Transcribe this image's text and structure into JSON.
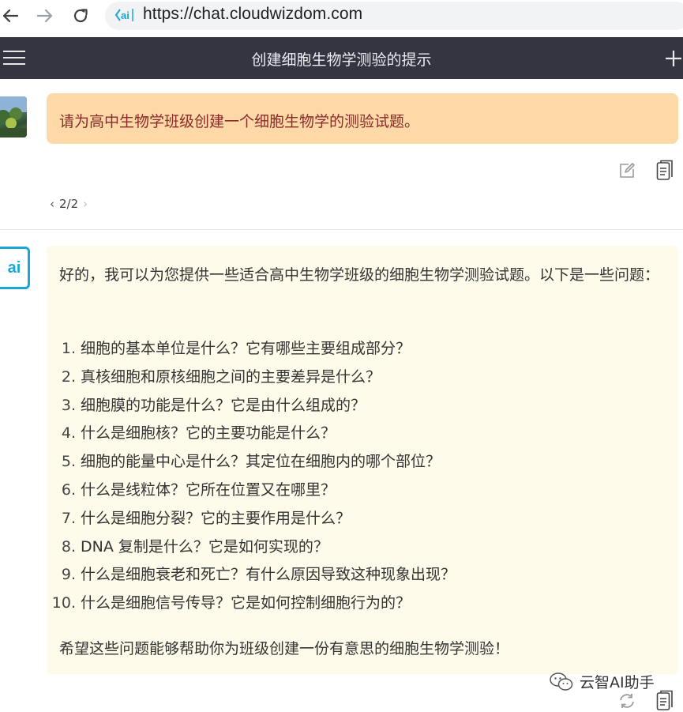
{
  "browser": {
    "url": "https://chat.cloudwizdom.com",
    "icons": [
      "back-arrow-icon",
      "forward-arrow-icon",
      "reload-icon",
      "site-logo-icon"
    ]
  },
  "header": {
    "title": "创建细胞生物学测验的提示",
    "icons": [
      "hamburger-menu-icon",
      "plus-icon"
    ]
  },
  "user_message": {
    "text": "请为高中生物学班级创建一个细胞生物学的测验试题。",
    "pager": "2/2",
    "icons": [
      "edit-icon",
      "copy-icon"
    ]
  },
  "ai_message": {
    "avatar_text": "ai",
    "intro": "好的，我可以为您提供一些适合高中生物学班级的细胞生物学测验试题。以下是一些问题：",
    "questions": [
      {
        "num": "1.",
        "text": "细胞的基本单位是什么？它有哪些主要组成部分？"
      },
      {
        "num": "2.",
        "text": "真核细胞和原核细胞之间的主要差异是什么？"
      },
      {
        "num": "3.",
        "text": "细胞膜的功能是什么？它是由什么组成的？"
      },
      {
        "num": "4.",
        "text": "什么是细胞核？它的主要功能是什么？"
      },
      {
        "num": "5.",
        "text": "细胞的能量中心是什么？其定位在细胞内的哪个部位？"
      },
      {
        "num": "6.",
        "text": "什么是线粒体？它所在位置又在哪里？"
      },
      {
        "num": "7.",
        "text": "什么是细胞分裂？它的主要作用是什么？"
      },
      {
        "num": "8.",
        "text": "DNA 复制是什么？它是如何实现的？"
      },
      {
        "num": "9.",
        "text": "什么是细胞衰老和死亡？有什么原因导致这种现象出现？"
      },
      {
        "num": "10.",
        "text": "什么是细胞信号传导？它是如何控制细胞行为的？"
      }
    ],
    "closing": "希望这些问题能够帮助你为班级创建一份有意思的细胞生物学测验！",
    "icons": [
      "regenerate-icon",
      "copy-icon"
    ]
  },
  "watermark": {
    "text": "云智AI助手",
    "icon": "wechat-logo-icon"
  },
  "colors": {
    "header_bg": "#343541",
    "user_bubble": "#fdd9a8",
    "ai_bubble": "#fffbea",
    "accent": "#1aa6d8"
  }
}
